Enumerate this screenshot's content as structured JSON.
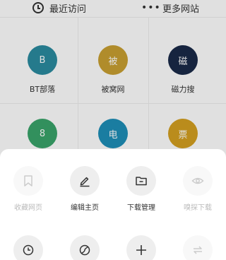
{
  "top_tabs": {
    "recent_label": "最近访问",
    "more_label": "更多网站",
    "more_glyph": "•••"
  },
  "sites": [
    {
      "label": "BT部落",
      "glyph": "B",
      "color": "#2b8ba0"
    },
    {
      "label": "被窝网",
      "glyph": "被",
      "color": "#c9a032"
    },
    {
      "label": "磁力搜",
      "glyph": "磁",
      "color": "#1a2a48"
    },
    {
      "label": "",
      "glyph": "8",
      "color": "#3aa46a"
    },
    {
      "label": "",
      "glyph": "电",
      "color": "#1e8fb8"
    },
    {
      "label": "",
      "glyph": "票",
      "color": "#d4a020"
    }
  ],
  "menu": {
    "row1": [
      {
        "label": "收藏网页",
        "icon": "bookmark-icon",
        "enabled": false
      },
      {
        "label": "编辑主页",
        "icon": "pencil-icon",
        "enabled": true
      },
      {
        "label": "下载管理",
        "icon": "download-folder-icon",
        "enabled": true
      },
      {
        "label": "嗅探下载",
        "icon": "eye-icon",
        "enabled": false
      }
    ],
    "row2": [
      {
        "label": "",
        "icon": "clock-icon",
        "enabled": true
      },
      {
        "label": "",
        "icon": "planet-icon",
        "enabled": true
      },
      {
        "label": "",
        "icon": "plus-icon",
        "enabled": true
      },
      {
        "label": "",
        "icon": "swap-icon",
        "enabled": false
      }
    ]
  },
  "colors": {
    "icon_enabled": "#333333",
    "icon_disabled": "#cccccc"
  }
}
